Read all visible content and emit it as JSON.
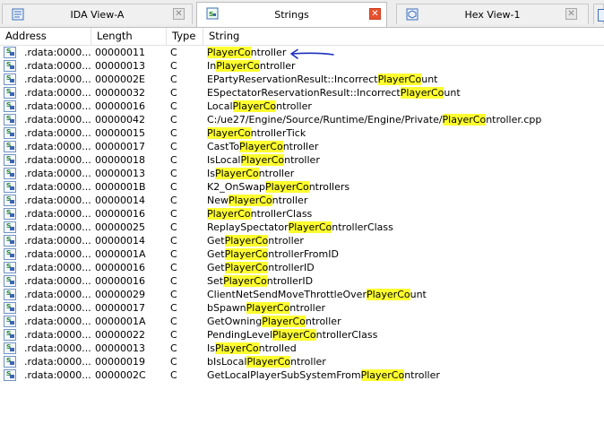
{
  "tabs": [
    {
      "label": "IDA View-A",
      "icon": "ida-view-icon",
      "active": false
    },
    {
      "label": "Strings",
      "icon": "strings-icon",
      "active": true
    },
    {
      "label": "Hex View-1",
      "icon": "hex-view-icon",
      "active": false
    }
  ],
  "columns": {
    "address": "Address",
    "length": "Length",
    "type": "Type",
    "string": "String"
  },
  "colors": {
    "highlight": "#ffff2f",
    "close_active": "#e8512e",
    "arrow": "#1a2fbf"
  },
  "rows": [
    {
      "address": ".rdata:0000...",
      "length": "00000011",
      "type": "C",
      "pre": "",
      "hl": "PlayerCo",
      "post": "ntroller"
    },
    {
      "address": ".rdata:0000...",
      "length": "00000013",
      "type": "C",
      "pre": "In",
      "hl": "PlayerCo",
      "post": "ntroller"
    },
    {
      "address": ".rdata:0000...",
      "length": "0000002E",
      "type": "C",
      "pre": "EPartyReservationResult::Incorrect",
      "hl": "PlayerCo",
      "post": "unt"
    },
    {
      "address": ".rdata:0000...",
      "length": "00000032",
      "type": "C",
      "pre": "ESpectatorReservationResult::Incorrect",
      "hl": "PlayerCo",
      "post": "unt"
    },
    {
      "address": ".rdata:0000...",
      "length": "00000016",
      "type": "C",
      "pre": "Local",
      "hl": "PlayerCo",
      "post": "ntroller"
    },
    {
      "address": ".rdata:0000...",
      "length": "00000042",
      "type": "C",
      "pre": "C:/ue27/Engine/Source/Runtime/Engine/Private/",
      "hl": "PlayerCo",
      "post": "ntroller.cpp"
    },
    {
      "address": ".rdata:0000...",
      "length": "00000015",
      "type": "C",
      "pre": "",
      "hl": "PlayerCo",
      "post": "ntrollerTick"
    },
    {
      "address": ".rdata:0000...",
      "length": "00000017",
      "type": "C",
      "pre": "CastTo",
      "hl": "PlayerCo",
      "post": "ntroller"
    },
    {
      "address": ".rdata:0000...",
      "length": "00000018",
      "type": "C",
      "pre": "IsLocal",
      "hl": "PlayerCo",
      "post": "ntroller"
    },
    {
      "address": ".rdata:0000...",
      "length": "00000013",
      "type": "C",
      "pre": "Is",
      "hl": "PlayerCo",
      "post": "ntroller"
    },
    {
      "address": ".rdata:0000...",
      "length": "0000001B",
      "type": "C",
      "pre": "K2_OnSwap",
      "hl": "PlayerCo",
      "post": "ntrollers"
    },
    {
      "address": ".rdata:0000...",
      "length": "00000014",
      "type": "C",
      "pre": "New",
      "hl": "PlayerCo",
      "post": "ntroller"
    },
    {
      "address": ".rdata:0000...",
      "length": "00000016",
      "type": "C",
      "pre": "",
      "hl": "PlayerCo",
      "post": "ntrollerClass"
    },
    {
      "address": ".rdata:0000...",
      "length": "00000025",
      "type": "C",
      "pre": "ReplaySpectator",
      "hl": "PlayerCo",
      "post": "ntrollerClass"
    },
    {
      "address": ".rdata:0000...",
      "length": "00000014",
      "type": "C",
      "pre": "Get",
      "hl": "PlayerCo",
      "post": "ntroller"
    },
    {
      "address": ".rdata:0000...",
      "length": "0000001A",
      "type": "C",
      "pre": "Get",
      "hl": "PlayerCo",
      "post": "ntrollerFromID"
    },
    {
      "address": ".rdata:0000...",
      "length": "00000016",
      "type": "C",
      "pre": "Get",
      "hl": "PlayerCo",
      "post": "ntrollerID"
    },
    {
      "address": ".rdata:0000...",
      "length": "00000016",
      "type": "C",
      "pre": "Set",
      "hl": "PlayerCo",
      "post": "ntrollerID"
    },
    {
      "address": ".rdata:0000...",
      "length": "00000029",
      "type": "C",
      "pre": "ClientNetSendMoveThrottleOver",
      "hl": "PlayerCo",
      "post": "unt"
    },
    {
      "address": ".rdata:0000...",
      "length": "00000017",
      "type": "C",
      "pre": "bSpawn",
      "hl": "PlayerCo",
      "post": "ntroller"
    },
    {
      "address": ".rdata:0000...",
      "length": "0000001A",
      "type": "C",
      "pre": "GetOwning",
      "hl": "PlayerCo",
      "post": "ntroller"
    },
    {
      "address": ".rdata:0000...",
      "length": "00000022",
      "type": "C",
      "pre": "PendingLevel",
      "hl": "PlayerCo",
      "post": "ntrollerClass"
    },
    {
      "address": ".rdata:0000...",
      "length": "00000013",
      "type": "C",
      "pre": "Is",
      "hl": "PlayerCo",
      "post": "ntrolled"
    },
    {
      "address": ".rdata:0000...",
      "length": "00000019",
      "type": "C",
      "pre": "bIsLocal",
      "hl": "PlayerCo",
      "post": "ntroller"
    },
    {
      "address": ".rdata:0000...",
      "length": "0000002C",
      "type": "C",
      "pre": "GetLocalPlayerSubSystemFrom",
      "hl": "PlayerCo",
      "post": "ntroller"
    }
  ]
}
